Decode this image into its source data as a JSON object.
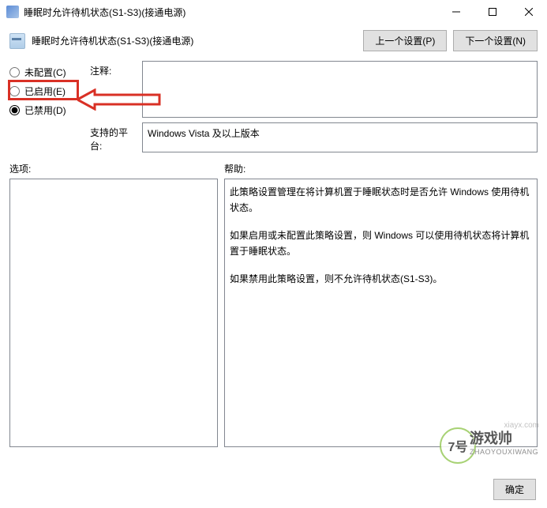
{
  "window": {
    "title": "睡眠时允许待机状态(S1-S3)(接通电源)"
  },
  "header": {
    "subtitle": "睡眠时允许待机状态(S1-S3)(接通电源)",
    "prev_btn": "上一个设置(P)",
    "next_btn": "下一个设置(N)"
  },
  "radios": {
    "not_configured": "未配置(C)",
    "enabled": "已启用(E)",
    "disabled": "已禁用(D)",
    "selected": "disabled"
  },
  "labels": {
    "comment": "注释:",
    "platform": "支持的平台:",
    "options": "选项:",
    "help": "帮助:"
  },
  "fields": {
    "comment_value": "",
    "platform_value": "Windows Vista 及以上版本"
  },
  "help": {
    "p1": "此策略设置管理在将计算机置于睡眠状态时是否允许 Windows 使用待机状态。",
    "p2": "如果启用或未配置此策略设置，则 Windows 可以使用待机状态将计算机置于睡眠状态。",
    "p3": "如果禁用此策略设置，则不允许待机状态(S1-S3)。"
  },
  "footer": {
    "ok": "确定"
  },
  "watermark": {
    "circle": "7号",
    "text": "游戏帅",
    "sub": "ZHAOYOUXIWANG",
    "url": "xiayx.com"
  }
}
